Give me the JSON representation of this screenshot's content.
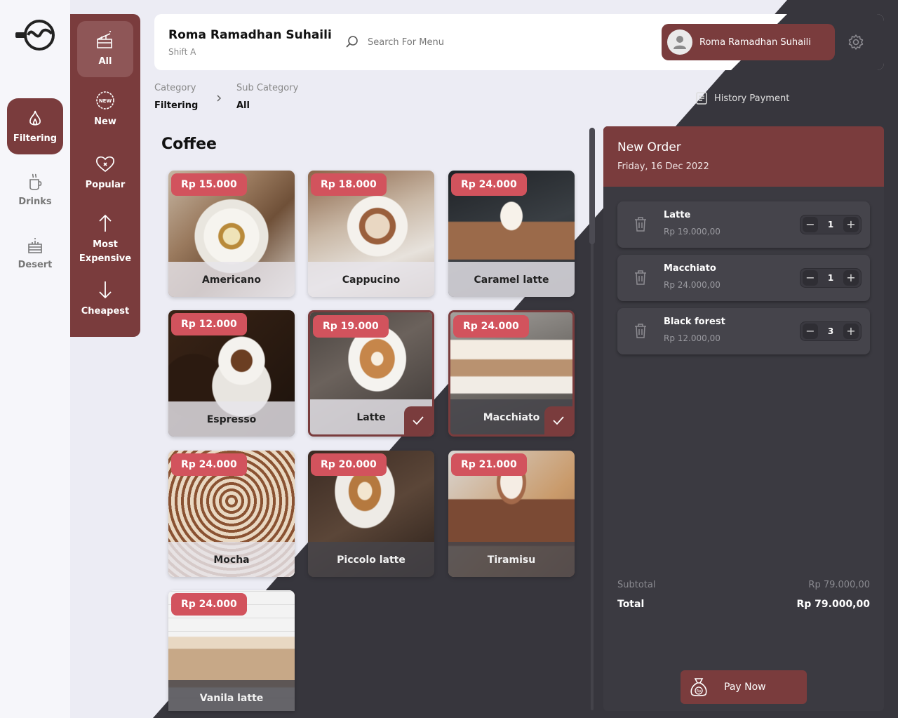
{
  "rail": {
    "items": [
      {
        "label": "Filtering",
        "icon": "flame-icon",
        "active": true
      },
      {
        "label": "Drinks",
        "icon": "cup-icon",
        "active": false
      },
      {
        "label": "Desert",
        "icon": "cake-icon",
        "active": false
      }
    ]
  },
  "filters": [
    {
      "label": "All",
      "icon": "cake-slice-icon",
      "active": true
    },
    {
      "label": "New",
      "icon": "new-badge-icon",
      "active": false
    },
    {
      "label": "Popular",
      "icon": "heart-icon",
      "active": false
    },
    {
      "label": "Most Expensive",
      "icon": "arrow-up-icon",
      "active": false
    },
    {
      "label": "Cheapest",
      "icon": "arrow-down-icon",
      "active": false
    }
  ],
  "header": {
    "user_name": "Roma Ramadhan Suhaili",
    "shift": "Shift A",
    "search_placeholder": "Search For Menu",
    "account_name": "Roma Ramadhan Suhaili"
  },
  "breadcrumb": {
    "category_label": "Category",
    "category_value": "Filtering",
    "subcategory_label": "Sub Category",
    "subcategory_value": "All"
  },
  "history_label": "History Payment",
  "section_title": "Coffee",
  "products": [
    {
      "name": "Americano",
      "price": "Rp 15.000",
      "selected": false
    },
    {
      "name": "Cappucino",
      "price": "Rp 18.000",
      "selected": false
    },
    {
      "name": "Caramel latte",
      "price": "Rp 24.000",
      "selected": false
    },
    {
      "name": "Espresso",
      "price": "Rp 12.000",
      "selected": false
    },
    {
      "name": "Latte",
      "price": "Rp 19.000",
      "selected": true
    },
    {
      "name": "Macchiato",
      "price": "Rp 24.000",
      "selected": true
    },
    {
      "name": "Mocha",
      "price": "Rp 24.000",
      "selected": false
    },
    {
      "name": "Piccolo latte",
      "price": "Rp 20.000",
      "selected": false
    },
    {
      "name": "Tiramisu",
      "price": "Rp 21.000",
      "selected": false
    },
    {
      "name": "Vanila latte",
      "price": "Rp 24.000",
      "selected": false
    }
  ],
  "order": {
    "title": "New Order",
    "date": "Friday, 16 Dec 2022",
    "items": [
      {
        "name": "Latte",
        "price": "Rp 19.000,00",
        "qty": "1"
      },
      {
        "name": "Macchiato",
        "price": "Rp 24.000,00",
        "qty": "1"
      },
      {
        "name": "Black forest",
        "price": "Rp 12.000,00",
        "qty": "3"
      }
    ],
    "subtotal_label": "Subtotal",
    "subtotal_value": "Rp 79.000,00",
    "total_label": "Total",
    "total_value": "Rp 79.000,00",
    "pay_label": "Pay Now"
  },
  "colors": {
    "brand": "#7a3c3d",
    "price_badge": "#d2535d",
    "dark_bg": "#37363d",
    "light_bg": "#ececf4"
  }
}
